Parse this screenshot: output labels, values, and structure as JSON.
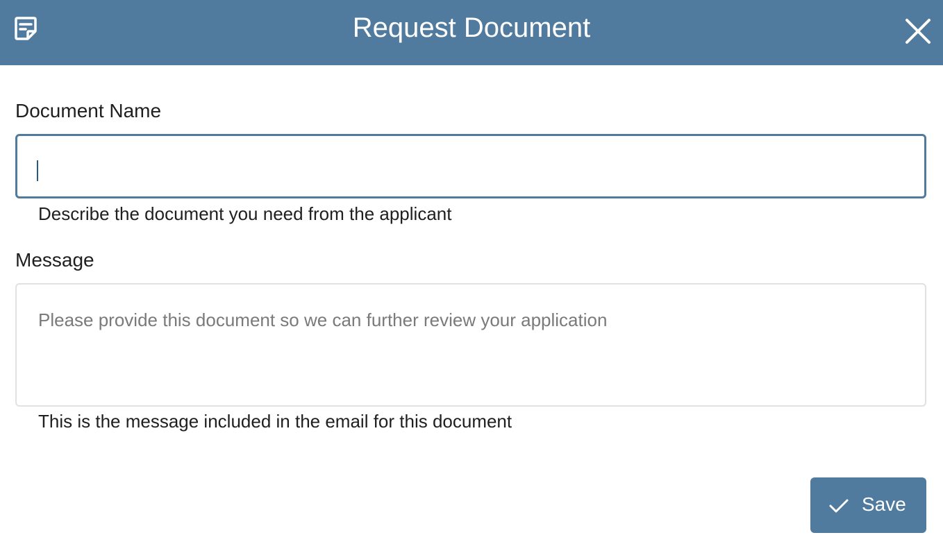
{
  "header": {
    "title": "Request Document",
    "icon": "note-icon",
    "close_icon": "close-icon",
    "background": "#517b9e"
  },
  "form": {
    "document_name": {
      "label": "Document Name",
      "value": "",
      "helper": "Describe the document you need from the applicant"
    },
    "message": {
      "label": "Message",
      "value": "",
      "placeholder": "Please provide this document so we can further review your application",
      "helper": "This is the message included in the email for this document"
    }
  },
  "actions": {
    "save_label": "Save",
    "save_icon": "check-icon"
  },
  "colors": {
    "accent": "#517b9e",
    "text": "#1f1f1f",
    "placeholder": "#7a7a7a",
    "border": "#e1e1e1"
  }
}
